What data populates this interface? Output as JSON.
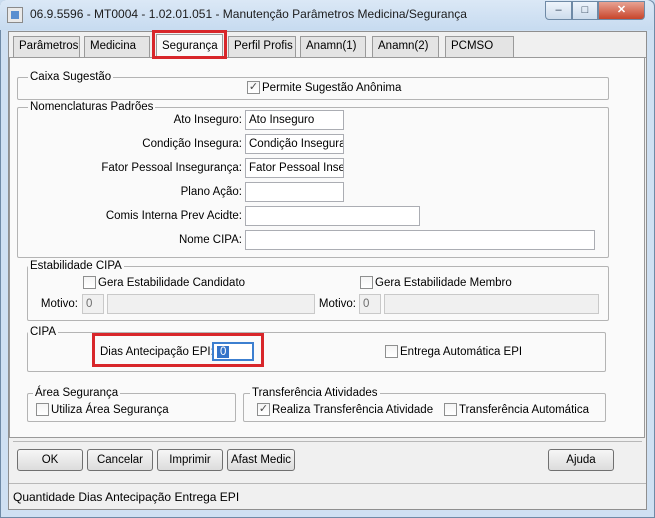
{
  "window": {
    "title": "06.9.5596 - MT0004 - 1.02.01.051 - Manutenção Parâmetros Medicina/Segurança",
    "minimize": "–",
    "maximize": "□",
    "close": "✕"
  },
  "tabs": [
    {
      "label": "Parâmetros"
    },
    {
      "label": "Medicina"
    },
    {
      "label": "Segurança",
      "active": true
    },
    {
      "label": "Perfil Profis"
    },
    {
      "label": "Anamn(1)"
    },
    {
      "label": "Anamn(2)"
    },
    {
      "label": "PCMSO"
    }
  ],
  "caixa_sugestao": {
    "legend": "Caixa Sugestão",
    "permite_label": "Permite Sugestão Anônima",
    "permite_checked": true
  },
  "nomenclaturas": {
    "legend": "Nomenclaturas Padrões",
    "ato_inseguro_label": "Ato Inseguro:",
    "ato_inseguro_value": "Ato Inseguro",
    "condicao_label": "Condição Insegura:",
    "condicao_value": "Condição Insegura",
    "fator_label": "Fator Pessoal Insegurança:",
    "fator_value": "Fator Pessoal Inseg",
    "plano_label": "Plano Ação:",
    "plano_value": "",
    "comis_label": "Comis Interna Prev Acidte:",
    "comis_value": "",
    "nome_cipa_label": "Nome CIPA:",
    "nome_cipa_value": ""
  },
  "estabilidade": {
    "legend": "Estabilidade CIPA",
    "candidato_label": "Gera Estabilidade Candidato",
    "candidato_checked": false,
    "membro_label": "Gera Estabilidade Membro",
    "membro_checked": false,
    "motivo1_label": "Motivo:",
    "motivo1_value": "0",
    "motivo2_label": "Motivo:",
    "motivo2_value": "0"
  },
  "cipa": {
    "legend": "CIPA",
    "dias_label": "Dias Antecipação EPI:",
    "dias_value": "0",
    "entrega_label": "Entrega Automática EPI",
    "entrega_checked": false
  },
  "area_seguranca": {
    "legend": "Área Segurança",
    "utiliza_label": "Utiliza Área Segurança",
    "utiliza_checked": false
  },
  "transferencia": {
    "legend": "Transferência Atividades",
    "realiza_label": "Realiza Transferência Atividade",
    "realiza_checked": true,
    "automatica_label": "Transferência Automática",
    "automatica_checked": false
  },
  "buttons": {
    "ok": "OK",
    "cancelar": "Cancelar",
    "imprimir": "Imprimir",
    "afast_medic": "Afast Medic",
    "ajuda": "Ajuda"
  },
  "status_bar": {
    "text": "Quantidade Dias Antecipação Entrega EPI"
  },
  "highlight_color": "#d8262a"
}
